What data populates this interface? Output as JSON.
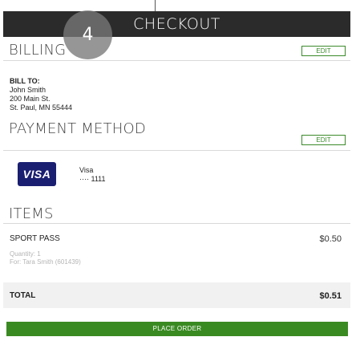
{
  "header": {
    "title": "CHECKOUT"
  },
  "step_badge": "4",
  "billing": {
    "title": "BILLING",
    "edit_label": "EDIT",
    "bill_to_label": "BILL TO:",
    "name": "John Smith",
    "address_line1": "200 Main St.",
    "address_line2": "St. Paul, MN 55444"
  },
  "payment": {
    "title": "PAYMENT METHOD",
    "edit_label": "EDIT",
    "card_logo": "VISA",
    "card_type": "Visa",
    "card_mask": "···· 1111"
  },
  "items": {
    "title": "ITEMS",
    "list": [
      {
        "name": "SPORT PASS",
        "price": "$0.50",
        "quantity": "Quantity: 1",
        "for": "For:   Tara Smith   (601439)"
      }
    ]
  },
  "total": {
    "label": "TOTAL",
    "value": "$0.51"
  },
  "actions": {
    "place_order": "PLACE ORDER"
  },
  "colors": {
    "header_bg": "#2b2b2b",
    "accent_green": "#3a8a22",
    "visa_blue": "#1a1f71"
  }
}
